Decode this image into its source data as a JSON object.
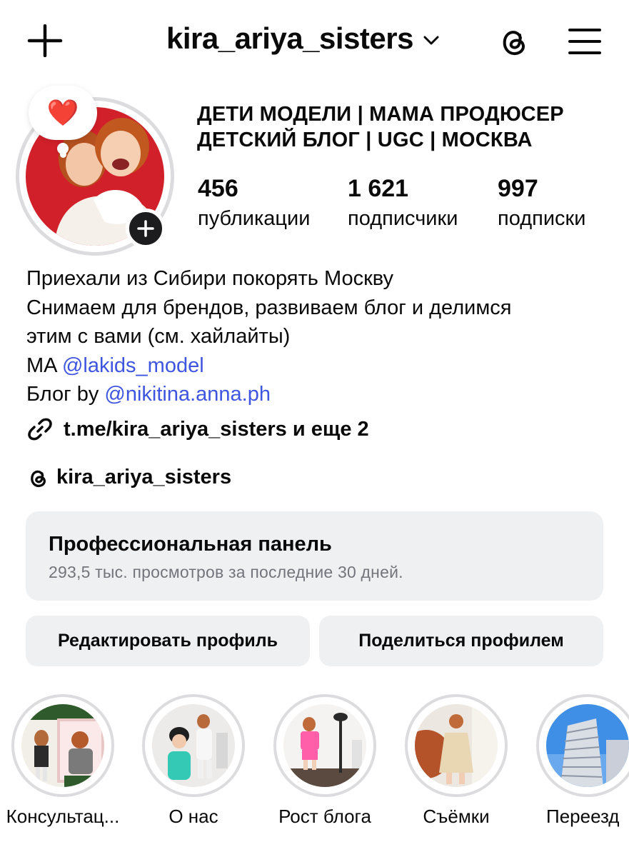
{
  "header": {
    "username": "kira_ariya_sisters"
  },
  "icons": {
    "new_post": "plus-icon",
    "account_switch": "chevron-down-icon",
    "threads": "threads-icon",
    "menu": "hamburger-menu-icon",
    "note": "heart-emoji-icon",
    "add_story": "plus-circle-icon",
    "link": "link-icon"
  },
  "note": {
    "emoji": "❤️"
  },
  "profile": {
    "category_line1": "ДЕТИ МОДЕЛИ | МАМА ПРОДЮСЕР",
    "category_line2": "ДЕТСКИЙ БЛОГ | UGC | МОСКВА",
    "stats": {
      "posts": {
        "value": "456",
        "label": "публикации"
      },
      "followers": {
        "value": "1 621",
        "label": "подписчики"
      },
      "following": {
        "value": "997",
        "label": "подписки"
      }
    }
  },
  "bio": {
    "line1": "Приехали из Сибири покорять Москву",
    "line2": "Снимаем для брендов, развиваем блог и делимся",
    "line3": "этим с вами (см. хайлайты)",
    "line4_prefix": "MA ",
    "line4_mention": "@lakids_model",
    "line5_prefix": "Блог by ",
    "line5_mention": "@nikitina.anna.ph",
    "link": "t.me/kira_ariya_sisters и еще 2",
    "threads_handle": "kira_ariya_sisters"
  },
  "pro_panel": {
    "title": "Профессиональная панель",
    "subtitle": "293,5 тыс. просмотров за последние 30 дней."
  },
  "buttons": {
    "edit_profile": "Редактировать профиль",
    "share_profile": "Поделиться профилем"
  },
  "highlights": [
    {
      "label": "Консультац..."
    },
    {
      "label": "О нас"
    },
    {
      "label": "Рост блога"
    },
    {
      "label": "Съёмки"
    },
    {
      "label": "Переезд"
    }
  ],
  "colors": {
    "mention": "#3e55e0",
    "panel_bg": "#eff0f2",
    "avatar_bg": "#d2202a"
  }
}
